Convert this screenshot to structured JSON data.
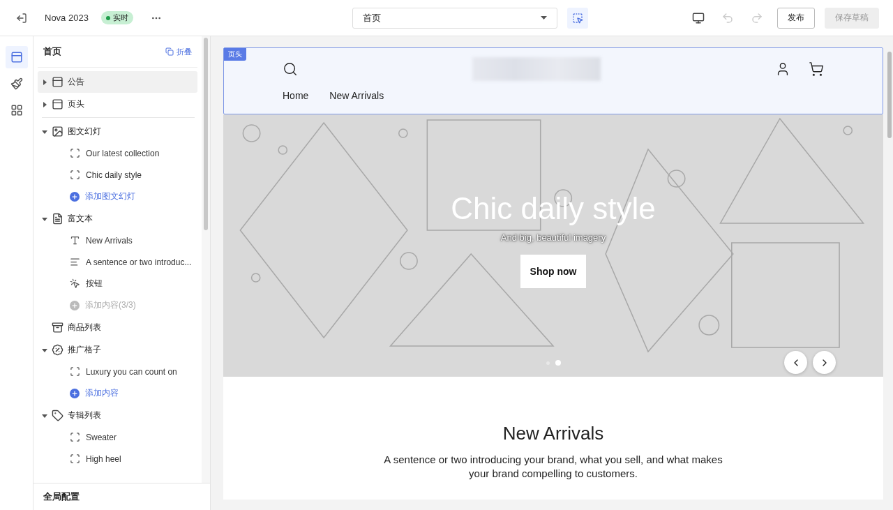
{
  "toolbar": {
    "store_name": "Nova 2023",
    "status": "实时",
    "page_select": "首页",
    "publish": "发布",
    "save_draft": "保存草稿",
    "save_disabled": true
  },
  "rail": [
    {
      "selected": true
    },
    {
      "selected": false
    },
    {
      "selected": false
    }
  ],
  "panel": {
    "title": "首页",
    "collapse": "折叠",
    "footer": "全局配置",
    "fixed_sections": [
      {
        "label": "公告",
        "expanded": false,
        "selected": true
      },
      {
        "label": "页头",
        "expanded": false,
        "selected": false
      }
    ],
    "sections": [
      {
        "label": "图文幻灯",
        "kind": "group",
        "expanded": true,
        "selected": false,
        "children": [
          {
            "kind": "frame",
            "label": "Our latest collection"
          },
          {
            "kind": "frame",
            "label": "Chic daily style"
          },
          {
            "kind": "add",
            "label": "添加图文幻灯",
            "disabled": false
          }
        ]
      },
      {
        "label": "富文本",
        "kind": "group",
        "expanded": true,
        "selected": false,
        "children": [
          {
            "kind": "text",
            "label": "New Arrivals"
          },
          {
            "kind": "paragraph",
            "label": "A sentence or two introduc..."
          },
          {
            "kind": "button",
            "label": "按钮"
          },
          {
            "kind": "add",
            "label": "添加内容(3/3)",
            "disabled": true
          }
        ]
      },
      {
        "label": "商品列表",
        "kind": "single",
        "selected": false
      },
      {
        "label": "推广格子",
        "kind": "group",
        "expanded": true,
        "selected": false,
        "children": [
          {
            "kind": "frame",
            "label": "Luxury you can count on"
          },
          {
            "kind": "add",
            "label": "添加内容",
            "disabled": false
          }
        ]
      },
      {
        "label": "专辑列表",
        "kind": "group",
        "expanded": true,
        "selected": false,
        "children": [
          {
            "kind": "frame",
            "label": "Sweater"
          },
          {
            "kind": "frame",
            "label": "High heel"
          }
        ]
      }
    ]
  },
  "preview": {
    "header_tag": "页头",
    "nav": [
      "Home",
      "New Arrivals"
    ],
    "hero": {
      "title": "Chic daily style",
      "subtitle": "And big, beautiful imagery",
      "button": "Shop now",
      "dots": [
        {
          "selected": false
        },
        {
          "selected": true
        }
      ]
    },
    "section": {
      "title": "New Arrivals",
      "text": "A sentence or two introducing your brand, what you sell, and what makes your brand compelling to customers."
    }
  }
}
